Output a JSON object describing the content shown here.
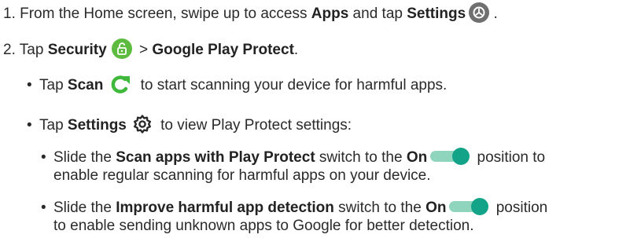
{
  "steps": {
    "step1": {
      "prefix": "1. From the Home screen, swipe up to access ",
      "apps": "Apps",
      "middle": " and tap ",
      "settings": "Settings",
      "suffix": " ."
    },
    "step2": {
      "prefix": "2. Tap ",
      "security": "Security",
      "separator": " > ",
      "play_protect": "Google Play Protect",
      "suffix": "."
    }
  },
  "bullets": {
    "scan": {
      "prefix": "Tap ",
      "label": "Scan",
      "suffix": " to start scanning your device for harmful apps."
    },
    "settings": {
      "prefix": "Tap ",
      "label": "Settings",
      "suffix": " to view Play Protect settings:"
    }
  },
  "sub_bullets": {
    "scan_apps": {
      "prefix": "Slide the ",
      "switch_name": "Scan apps with Play Protect",
      "middle": " switch to the ",
      "on": "On",
      "suffix": " position to",
      "continuation": "enable regular scanning for harmful apps on your device."
    },
    "improve": {
      "prefix": "Slide the ",
      "switch_name": "Improve harmful app detection",
      "middle": " switch to the ",
      "on": "On",
      "suffix": " position",
      "continuation": "to enable sending unknown apps to Google for better detection."
    }
  },
  "bullet_glyph": "•",
  "colors": {
    "security_green": "#5dbb3f",
    "scan_green": "#3fb83c",
    "settings_gray": "#6f6f6f",
    "toggle_thumb": "#12a388",
    "toggle_track": "#8fd5bd"
  },
  "icons": [
    "settings-app-icon",
    "security-lock-icon",
    "scan-refresh-icon",
    "settings-gear-icon",
    "toggle-on-icon"
  ]
}
